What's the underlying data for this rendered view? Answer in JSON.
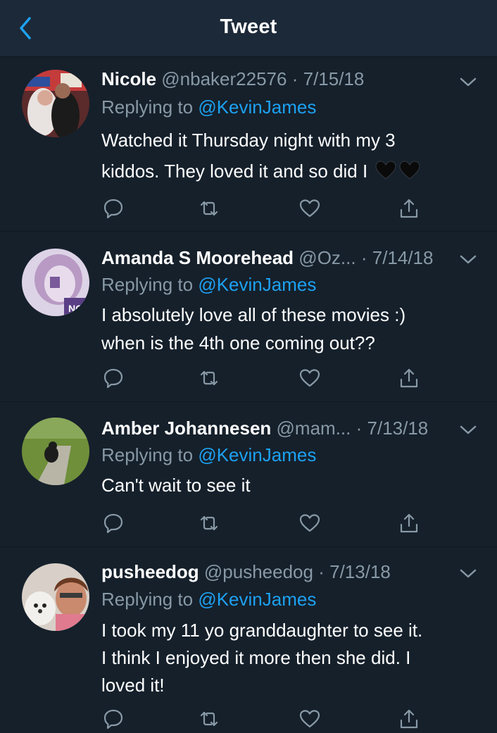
{
  "navbar": {
    "title": "Tweet",
    "back_icon": "chevron-left-icon"
  },
  "colors": {
    "background": "#15202b",
    "navbar": "#1c2938",
    "accent": "#1da1f2",
    "muted": "#8899a6"
  },
  "replying_label": "Replying to",
  "tweets": [
    {
      "name": "Nicole",
      "handle": "@nbaker22576",
      "separator": "·",
      "date": "7/15/18",
      "reply_to": "@KevinJames",
      "text_lines": [
        "Watched it Thursday night with my 3",
        "kiddos. They loved it and so did I"
      ],
      "emoji": [
        "black-heart",
        "black-heart"
      ]
    },
    {
      "name": "Amanda S Moorehead",
      "handle": "@Oz...",
      "separator": "·",
      "date": "7/14/18",
      "reply_to": "@KevinJames",
      "text_lines": [
        "I absolutely love all of these movies :)",
        "when is the 4th one coming out??"
      ]
    },
    {
      "name": "Amber Johannesen",
      "handle": "@mam...",
      "separator": "·",
      "date": "7/13/18",
      "reply_to": "@KevinJames",
      "text_lines": [
        "Can't wait to see it"
      ]
    },
    {
      "name": "pusheedog",
      "handle": "@pusheedog",
      "separator": "·",
      "date": "7/13/18",
      "reply_to": "@KevinJames",
      "text_lines": [
        "I took my 11 yo granddaughter to see it.",
        "I think I enjoyed it more then she did.  I",
        "loved it!"
      ]
    }
  ],
  "action_icons": [
    "reply-icon",
    "retweet-icon",
    "like-icon",
    "share-icon"
  ]
}
